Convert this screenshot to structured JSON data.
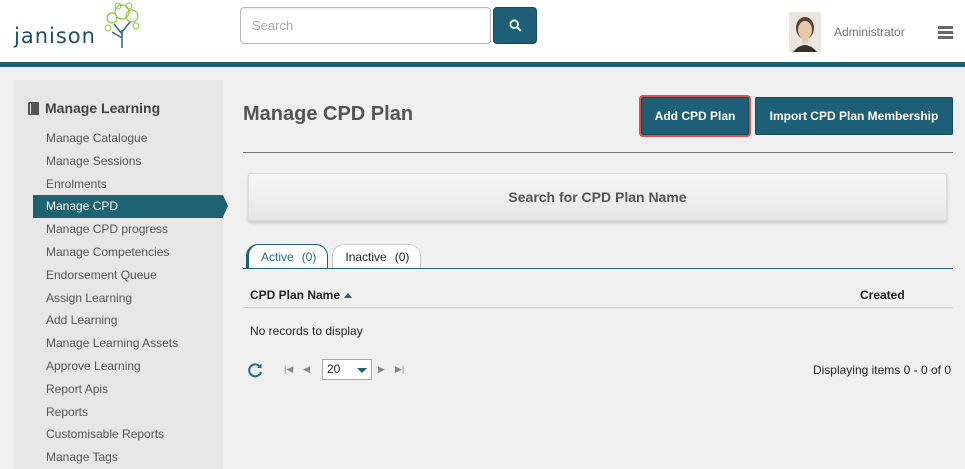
{
  "header": {
    "logo_text": "janison",
    "search": {
      "placeholder": "Search",
      "value": ""
    },
    "user": {
      "name": "Administrator"
    }
  },
  "sidebar": {
    "heading": "Manage Learning",
    "items": [
      {
        "label": "Manage Catalogue",
        "active": false
      },
      {
        "label": "Manage Sessions",
        "active": false
      },
      {
        "label": "Enrolments",
        "active": false
      },
      {
        "label": "Manage CPD",
        "active": true
      },
      {
        "label": "Manage CPD progress",
        "active": false
      },
      {
        "label": "Manage Competencies",
        "active": false
      },
      {
        "label": "Endorsement Queue",
        "active": false
      },
      {
        "label": "Assign Learning",
        "active": false
      },
      {
        "label": "Add Learning",
        "active": false
      },
      {
        "label": "Manage Learning Assets",
        "active": false
      },
      {
        "label": "Approve Learning",
        "active": false
      },
      {
        "label": "Report Apis",
        "active": false
      },
      {
        "label": "Reports",
        "active": false
      },
      {
        "label": "Customisable Reports",
        "active": false
      },
      {
        "label": "Manage Tags",
        "active": false
      }
    ]
  },
  "main": {
    "title": "Manage CPD Plan",
    "add_button": "Add CPD Plan",
    "import_button": "Import CPD Plan Membership",
    "search_panel": "Search for CPD Plan Name",
    "tabs": [
      {
        "label": "Active",
        "count": "(0)",
        "active": true
      },
      {
        "label": "Inactive",
        "count": "(0)",
        "active": false
      }
    ],
    "table": {
      "columns": [
        "CPD Plan Name",
        "Created"
      ],
      "sort": "ascending",
      "empty_message": "No records to display"
    },
    "pager": {
      "page_size": "20",
      "info": "Displaying items 0 - 0 of 0"
    }
  },
  "colors": {
    "brand": "#1d6374",
    "button": "#1d5f76",
    "highlight": "#d9534f"
  }
}
